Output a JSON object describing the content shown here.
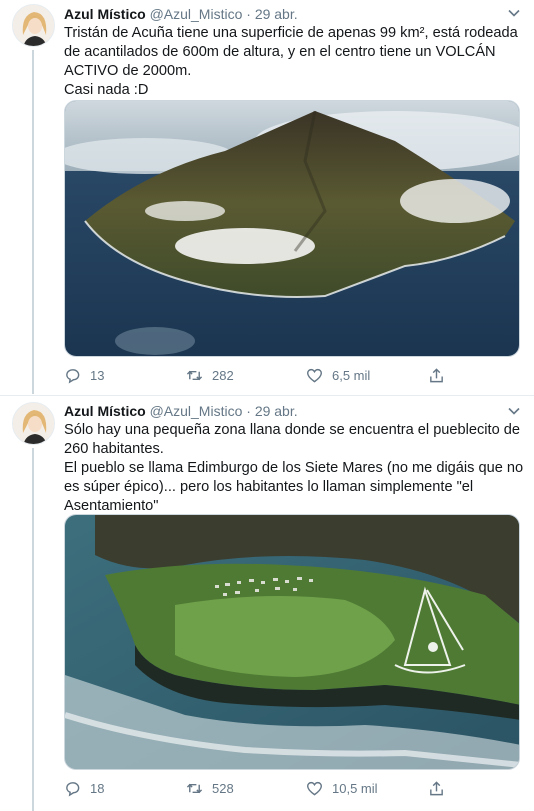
{
  "tweets": [
    {
      "author_name": "Azul Místico",
      "author_handle": "@Azul_Mistico",
      "separator": "·",
      "date": "29 abr.",
      "paragraphs": [
        "Tristán de Acuña tiene una superficie de apenas 99 km², está rodeada de acantilados de 600m de altura, y en el centro tiene un VOLCÁN ACTIVO de 2000m.",
        "Casi nada :D"
      ],
      "media_icon": "volcanic-island-photo",
      "replies": "13",
      "retweets": "282",
      "likes": "6,5 mil"
    },
    {
      "author_name": "Azul Místico",
      "author_handle": "@Azul_Mistico",
      "separator": "·",
      "date": "29 abr.",
      "paragraphs": [
        "Sólo hay una pequeña zona llana donde se encuentra el pueblecito de 260 habitantes.",
        "El pueblo se llama Edimburgo de los Siete Mares (no me digáis que no es súper épico)... pero los habitantes lo llaman simplemente \"el Asentamiento\""
      ],
      "media_icon": "settlement-aerial-photo",
      "replies": "18",
      "retweets": "528",
      "likes": "10,5 mil"
    }
  ],
  "colors": {
    "text": "#14171a",
    "muted": "#657786",
    "border": "#e6ecf0"
  }
}
